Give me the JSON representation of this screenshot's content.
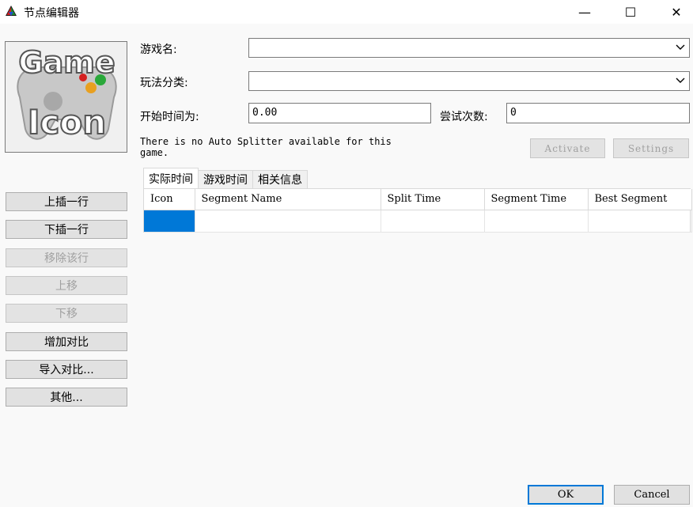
{
  "window": {
    "title": "节点编辑器",
    "minimize": "—",
    "maximize": "☐",
    "close": "✕"
  },
  "game_icon": {
    "line1": "Game",
    "line2": "Icon"
  },
  "fields": {
    "game_name_label": "游戏名:",
    "game_name_value": "",
    "category_label": "玩法分类:",
    "category_value": "",
    "start_time_label": "开始时间为:",
    "start_time_value": "0.00",
    "attempts_label": "尝试次数:",
    "attempts_value": "0"
  },
  "autosplitter": {
    "note": "There is no Auto Splitter available for this game.",
    "activate": "Activate",
    "settings": "Settings"
  },
  "side_buttons": [
    {
      "label": "上插一行",
      "enabled": true
    },
    {
      "label": "下插一行",
      "enabled": true
    },
    {
      "label": "移除该行",
      "enabled": false
    },
    {
      "label": "上移",
      "enabled": false
    },
    {
      "label": "下移",
      "enabled": false
    },
    {
      "label": "增加对比",
      "enabled": true
    },
    {
      "label": "导入对比...",
      "enabled": true
    },
    {
      "label": "其他...",
      "enabled": true
    }
  ],
  "tabs": [
    "实际时间",
    "游戏时间",
    "相关信息"
  ],
  "table": {
    "columns": [
      "Icon",
      "Segment Name",
      "Split Time",
      "Segment Time",
      "Best Segment"
    ],
    "rows": [
      [
        "",
        "",
        "",
        "",
        ""
      ]
    ]
  },
  "footer": {
    "ok": "OK",
    "cancel": "Cancel"
  },
  "colors": {
    "accent": "#0078d7"
  }
}
